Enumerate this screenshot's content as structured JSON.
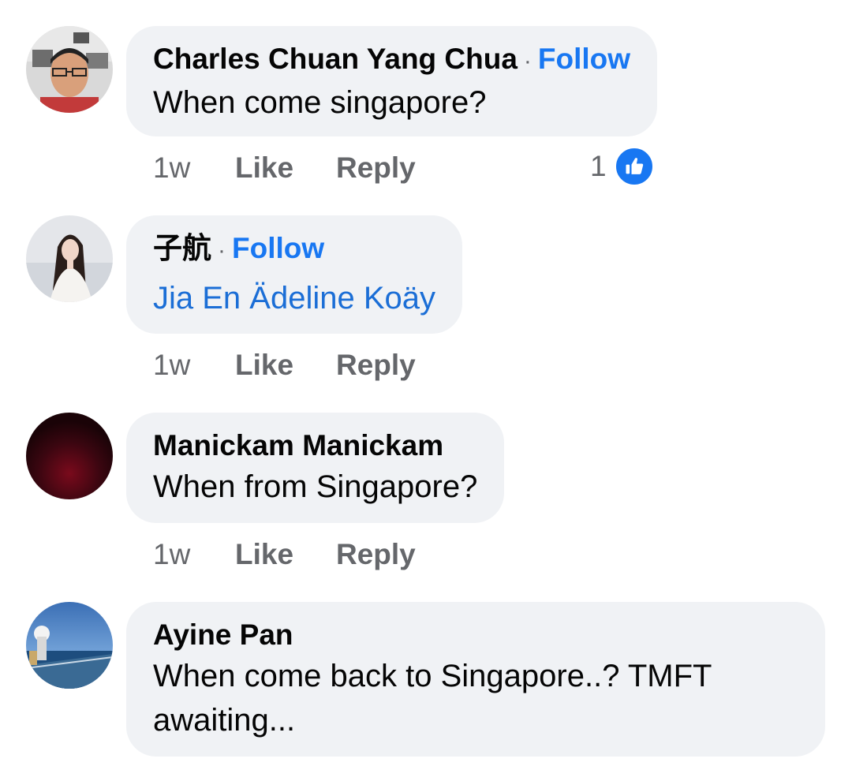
{
  "comments": [
    {
      "author": "Charles Chuan Yang Chua",
      "separator": "·",
      "follow_label": "Follow",
      "text": "When come singapore?",
      "timestamp": "1w",
      "like_label": "Like",
      "reply_label": "Reply",
      "reaction_count": "1",
      "reaction_icon": "like-reaction-icon"
    },
    {
      "author": "子航",
      "separator": "·",
      "follow_label": "Follow",
      "mention": "Jia En Ädeline Koäy",
      "timestamp": "1w",
      "like_label": "Like",
      "reply_label": "Reply"
    },
    {
      "author": "Manickam Manickam",
      "text": "When from Singapore?",
      "timestamp": "1w",
      "like_label": "Like",
      "reply_label": "Reply"
    },
    {
      "author": "Ayine Pan",
      "text": "When come back to Singapore..? TMFT awaiting..."
    }
  ],
  "colors": {
    "bubble": "#f0f2f5",
    "follow": "#1877f2",
    "mention": "#1b6ed6",
    "meta": "#65676b"
  }
}
